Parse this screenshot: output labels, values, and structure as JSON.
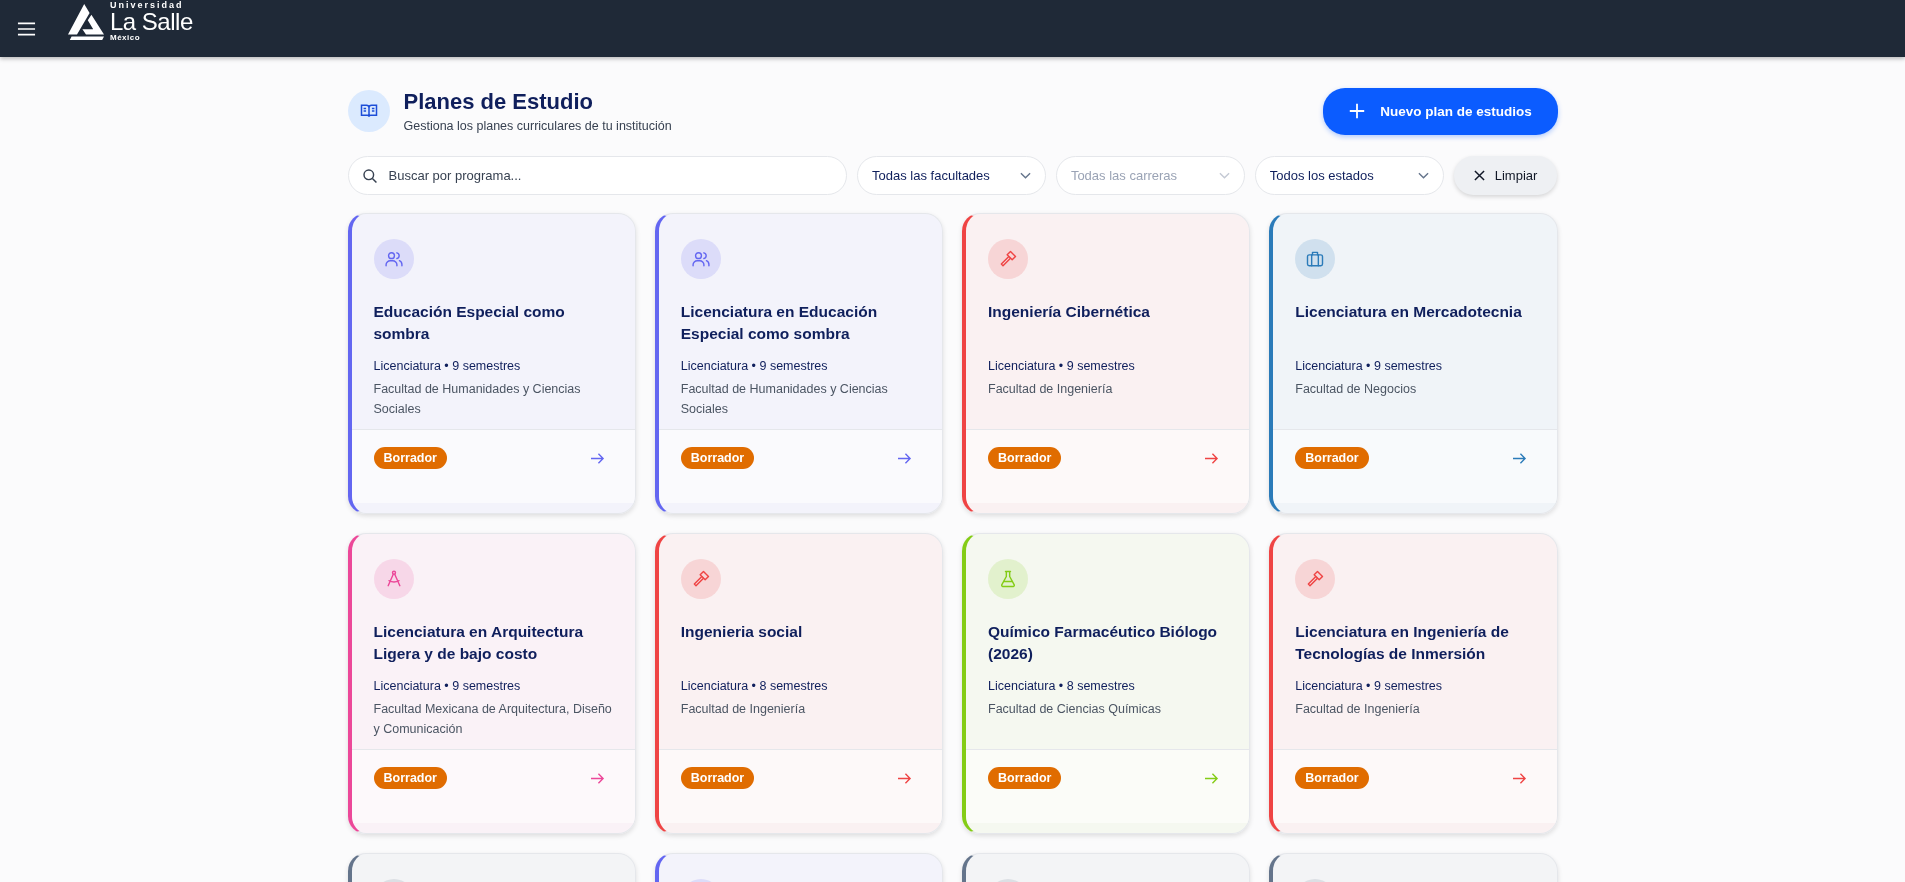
{
  "header": {
    "logo_top": "Universidad",
    "logo_name": "La Salle",
    "logo_sub": "México"
  },
  "page": {
    "title": "Planes de Estudio",
    "subtitle": "Gestiona los planes curriculares de tu institución",
    "new_button": "Nuevo plan de estudios"
  },
  "filters": {
    "search": {
      "placeholder": "Buscar por programa..."
    },
    "selects": [
      {
        "label": "Todas las facultades",
        "disabled": false
      },
      {
        "label": "Todas las carreras",
        "disabled": true
      },
      {
        "label": "Todos los estados",
        "disabled": false
      }
    ],
    "clear_button": "Limpiar"
  },
  "cards": [
    {
      "kind": "people",
      "color": "#6366f1",
      "title": "Educación Especial como sombra",
      "meta": "Licenciatura • 9 semestres",
      "faculty": "Facultad de Humanidades y Ciencias Sociales",
      "status": "Borrador"
    },
    {
      "kind": "people",
      "color": "#6366f1",
      "title": "Licenciatura en Educación Especial como sombra",
      "meta": "Licenciatura • 9 semestres",
      "faculty": "Facultad de Humanidades y Ciencias Sociales",
      "status": "Borrador"
    },
    {
      "kind": "hammer",
      "color": "#ef4444",
      "title": "Ingeniería Cibernética",
      "meta": "Licenciatura • 9 semestres",
      "faculty": "Facultad de Ingeniería",
      "status": "Borrador"
    },
    {
      "kind": "briefcase",
      "color": "#2b7bb9",
      "title": "Licenciatura en Mercadotecnia",
      "meta": "Licenciatura • 9 semestres",
      "faculty": "Facultad de Negocios",
      "status": "Borrador"
    },
    {
      "kind": "compass",
      "color": "#ec4899",
      "title": "Licenciatura en Arquitectura Ligera y de bajo costo",
      "meta": "Licenciatura • 9 semestres",
      "faculty": "Facultad Mexicana de Arquitectura, Diseño y Comunicación",
      "status": "Borrador"
    },
    {
      "kind": "hammer",
      "color": "#ef4444",
      "title": "Ingenieria social",
      "meta": "Licenciatura • 8 semestres",
      "faculty": "Facultad de Ingeniería",
      "status": "Borrador"
    },
    {
      "kind": "flask",
      "color": "#84cc16",
      "title": "Químico Farmacéutico Biólogo (2026)",
      "meta": "Licenciatura • 8 semestres",
      "faculty": "Facultad de Ciencias Químicas",
      "status": "Borrador"
    },
    {
      "kind": "hammer",
      "color": "#ef4444",
      "title": "Licenciatura en Ingeniería de Tecnologías de Inmersión",
      "meta": "Licenciatura • 9 semestres",
      "faculty": "Facultad de Ingeniería",
      "status": "Borrador"
    }
  ],
  "partial_cards": [
    {
      "color": "#64748b"
    },
    {
      "color": "#6366f1"
    },
    {
      "color": "#64748b"
    },
    {
      "color": "#64748b"
    }
  ]
}
